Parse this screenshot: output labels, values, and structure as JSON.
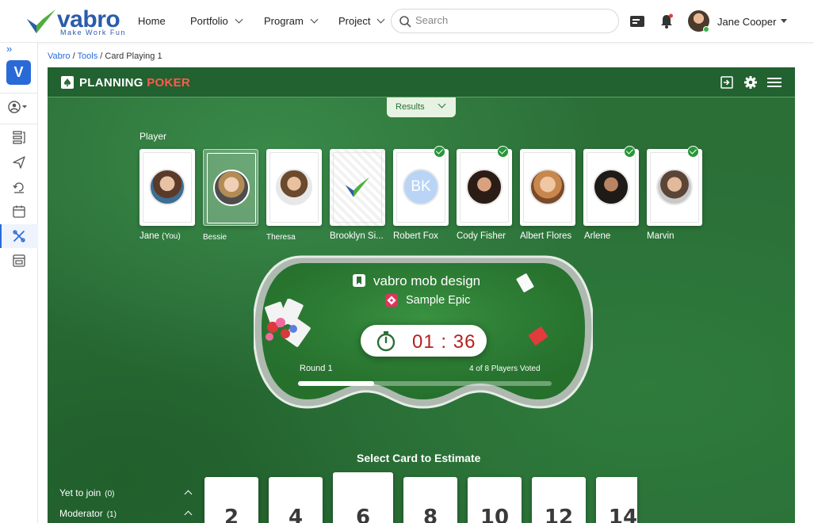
{
  "brand": {
    "name": "vabro",
    "tagline": "Make Work Fun"
  },
  "nav": [
    {
      "label": "Home",
      "has_menu": false
    },
    {
      "label": "Portfolio",
      "has_menu": true
    },
    {
      "label": "Program",
      "has_menu": true
    },
    {
      "label": "Project",
      "has_menu": true
    }
  ],
  "search": {
    "placeholder": "Search",
    "value": ""
  },
  "user": {
    "name": "Jane Cooper",
    "status": "online"
  },
  "rail": {
    "workspace_initial": "V"
  },
  "breadcrumb": {
    "root": "Vabro",
    "section": "Tools",
    "current": "Card Playing 1"
  },
  "game": {
    "title_main": "PLANNING",
    "title_accent": "POKER",
    "results_label": "Results",
    "player_section_label": "Player",
    "players": [
      {
        "name": "Jane",
        "suffix": "(You)",
        "voted": false,
        "card": "face"
      },
      {
        "name": "Bessie",
        "suffix": "",
        "voted": false,
        "card": "face",
        "selected": true
      },
      {
        "name": "Theresa",
        "suffix": "",
        "voted": false,
        "card": "face"
      },
      {
        "name": "Brooklyn Si...",
        "suffix": "",
        "voted": false,
        "card": "back"
      },
      {
        "name": "Robert Fox",
        "suffix": "",
        "voted": true,
        "card": "initials",
        "initials": "BK"
      },
      {
        "name": "Cody Fisher",
        "suffix": "",
        "voted": true,
        "card": "face"
      },
      {
        "name": "Albert Flores",
        "suffix": "",
        "voted": false,
        "card": "face"
      },
      {
        "name": "Arlene",
        "suffix": "",
        "voted": true,
        "card": "face"
      },
      {
        "name": "Marvin",
        "suffix": "",
        "voted": true,
        "card": "face"
      }
    ],
    "project_name": "vabro mob design",
    "epic_name": "Sample Epic",
    "timer": {
      "minutes": "01",
      "separator": ":",
      "seconds": "36"
    },
    "round_label": "Round 1",
    "voted_label": "4 of 8 Players Voted",
    "vote_progress": 0.3,
    "select_label": "Select Card to Estimate",
    "estimate_cards": [
      "2",
      "4",
      "6",
      "8",
      "10",
      "12",
      "14"
    ],
    "lifted_card": "6",
    "side_panels": [
      {
        "label": "Yet to join",
        "count": "(0)"
      },
      {
        "label": "Moderator",
        "count": "(1)"
      }
    ]
  },
  "colors": {
    "brand_blue": "#2a5caa",
    "accent_blue": "#2a6ad8",
    "felt_green": "#2b6f37",
    "check_green": "#27963b",
    "poker_red": "#ff5a4e",
    "timer_red": "#b52020"
  }
}
